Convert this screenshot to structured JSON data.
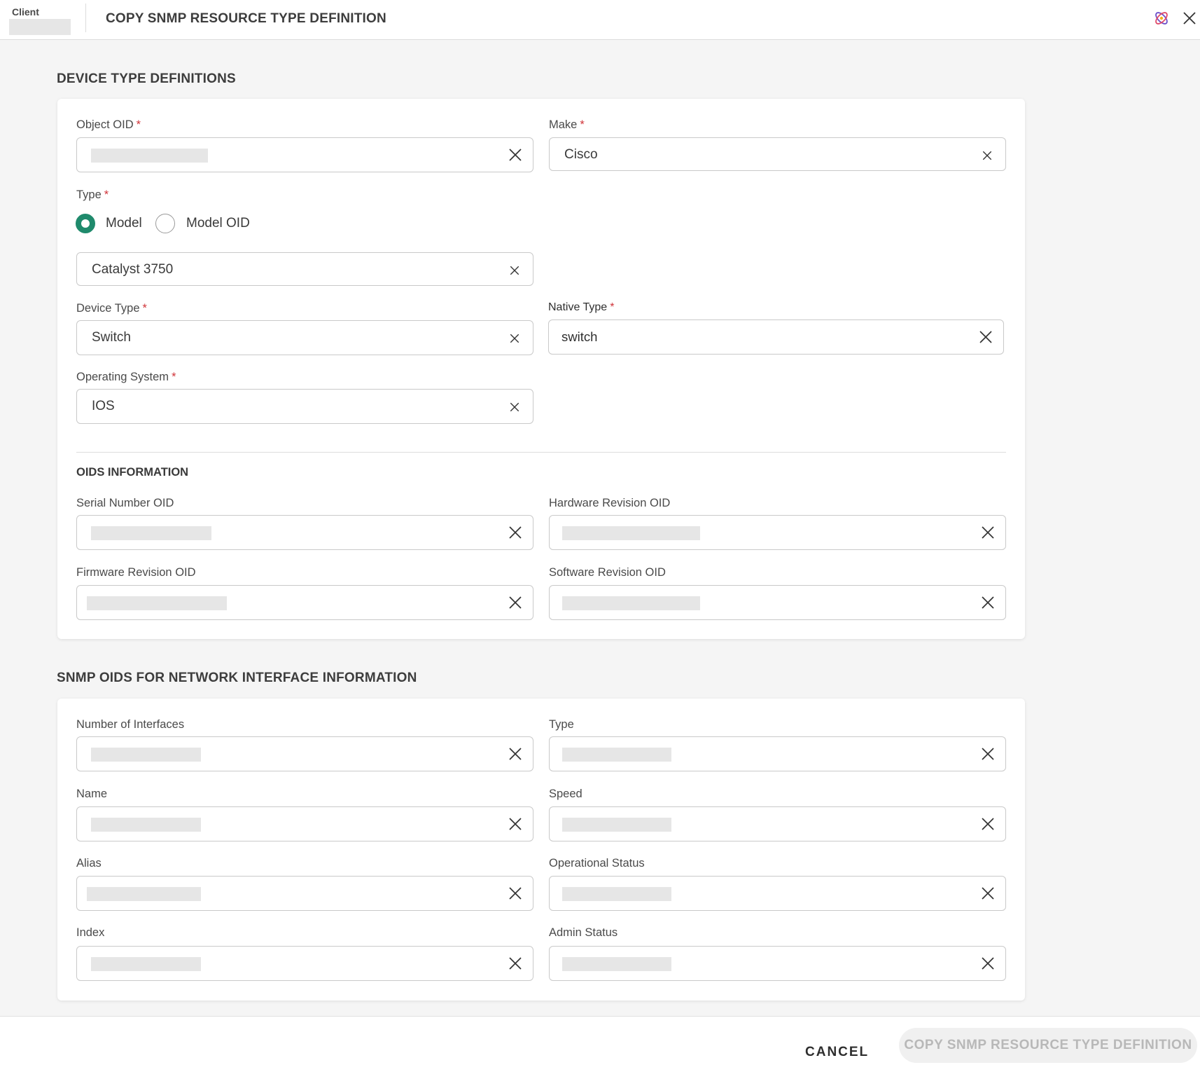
{
  "header": {
    "client_label": "Client",
    "title": "COPY SNMP RESOURCE TYPE DEFINITION"
  },
  "device_type": {
    "section_title": "DEVICE TYPE DEFINITIONS",
    "object_oid": {
      "label": "Object OID",
      "value": ""
    },
    "make": {
      "label": "Make",
      "value": "Cisco"
    },
    "type": {
      "label": "Type",
      "options": [
        "Model",
        "Model OID"
      ],
      "selected": "Model",
      "value": "Catalyst 3750"
    },
    "device_type": {
      "label": "Device Type",
      "value": "Switch"
    },
    "native_type": {
      "label": "Native Type",
      "value": "switch"
    },
    "operating_system": {
      "label": "Operating System",
      "value": "IOS"
    },
    "oids_title": "OIDS INFORMATION",
    "serial_number_oid": {
      "label": "Serial Number OID"
    },
    "hardware_revision_oid": {
      "label": "Hardware Revision OID"
    },
    "firmware_revision_oid": {
      "label": "Firmware Revision OID"
    },
    "software_revision_oid": {
      "label": "Software Revision OID"
    }
  },
  "interfaces": {
    "section_title": "SNMP OIDS FOR NETWORK INTERFACE INFORMATION",
    "number_of_interfaces": {
      "label": "Number of Interfaces"
    },
    "type": {
      "label": "Type"
    },
    "name": {
      "label": "Name"
    },
    "speed": {
      "label": "Speed"
    },
    "alias": {
      "label": "Alias"
    },
    "operational_status": {
      "label": "Operational Status"
    },
    "index": {
      "label": "Index"
    },
    "admin_status": {
      "label": "Admin Status"
    }
  },
  "required_marker": "*",
  "footer": {
    "cancel_label": "CANCEL",
    "submit_label": "COPY SNMP RESOURCE TYPE DEFINITION"
  },
  "colors": {
    "accent": "#1f8a6c",
    "required": "#d0353a",
    "disabled_button_bg": "#f0f0f0",
    "disabled_button_text": "#b8b8b8"
  },
  "icons": {
    "clear": "close-x-icon",
    "window_close": "close-icon",
    "brand": "brand-logo-icon"
  }
}
